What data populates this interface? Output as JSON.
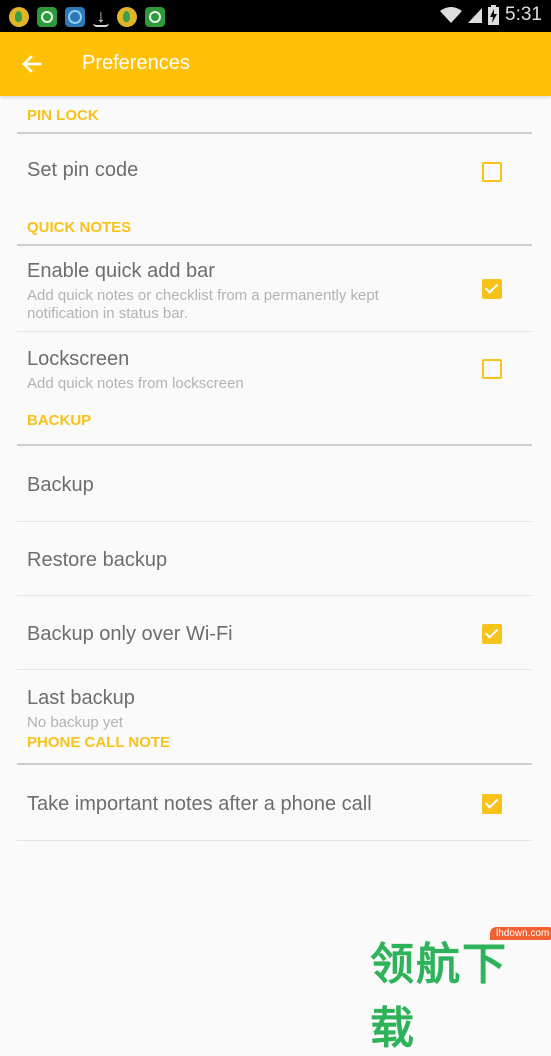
{
  "status_bar": {
    "notification_icons": [
      "music-app-icon",
      "green-sync-app-icon",
      "blue-app-icon",
      "download-icon",
      "music-app-icon",
      "green-sync-app-icon"
    ],
    "right_icons": [
      "wifi-icon",
      "cell-signal-icon",
      "battery-charging-icon"
    ],
    "time": "5:31"
  },
  "toolbar": {
    "back_icon": "arrow-left-icon",
    "title": "Preferences",
    "background_color": "#ffc107"
  },
  "accent_color": "#f7c21a",
  "sections": [
    {
      "header": "PIN LOCK",
      "items": [
        {
          "title": "Set pin code",
          "checkbox": true,
          "checked": false
        }
      ]
    },
    {
      "header": "QUICK NOTES",
      "items": [
        {
          "title": "Enable quick add bar",
          "summary": "Add quick notes or checklist from a permanently kept notification in status bar.",
          "checkbox": true,
          "checked": true
        },
        {
          "title": "Lockscreen",
          "summary": "Add quick notes from lockscreen",
          "checkbox": true,
          "checked": false
        }
      ]
    },
    {
      "header": "BACKUP",
      "items": [
        {
          "title": "Backup"
        },
        {
          "title": "Restore backup"
        },
        {
          "title": "Backup only over Wi-Fi",
          "checkbox": true,
          "checked": true
        },
        {
          "title": "Last backup",
          "summary": "No backup yet"
        }
      ]
    },
    {
      "header": "PHONE CALL NOTE",
      "items": [
        {
          "title": "Take important notes after a phone call",
          "checkbox": true,
          "checked": true
        }
      ]
    }
  ],
  "watermark": {
    "text": "领航下载",
    "badge": "lhdown.com"
  }
}
